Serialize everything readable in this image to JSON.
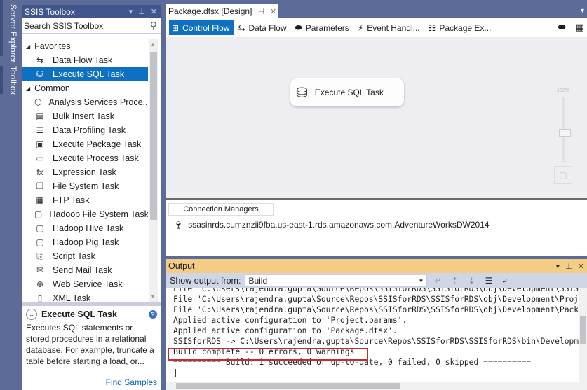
{
  "side_rail": {
    "tabs": [
      "Server Explorer",
      "Toolbox"
    ]
  },
  "toolbox": {
    "title": "SSIS Toolbox",
    "title_buttons": [
      "▾",
      "⊥",
      "✕"
    ],
    "search_placeholder": "Search SSIS Toolbox",
    "groups": [
      {
        "label": "Favorites",
        "items": [
          {
            "label": "Data Flow Task",
            "icon": "data-flow-icon",
            "glyph": "⇆"
          },
          {
            "label": "Execute SQL Task",
            "icon": "execute-sql-icon",
            "glyph": "⛁",
            "selected": true
          }
        ]
      },
      {
        "label": "Common",
        "items": [
          {
            "label": "Analysis Services Proce...",
            "icon": "cube-icon",
            "glyph": "⬡"
          },
          {
            "label": "Bulk Insert Task",
            "icon": "bulk-insert-icon",
            "glyph": "▤"
          },
          {
            "label": "Data Profiling Task",
            "icon": "profiling-icon",
            "glyph": "☰"
          },
          {
            "label": "Execute Package Task",
            "icon": "execute-package-icon",
            "glyph": "▣"
          },
          {
            "label": "Execute Process Task",
            "icon": "execute-process-icon",
            "glyph": "▭"
          },
          {
            "label": "Expression Task",
            "icon": "fx-icon",
            "glyph": "fx"
          },
          {
            "label": "File System Task",
            "icon": "file-system-icon",
            "glyph": "❐"
          },
          {
            "label": "FTP Task",
            "icon": "ftp-icon",
            "glyph": "▦"
          },
          {
            "label": "Hadoop File System Task",
            "icon": "hdfs-icon",
            "glyph": "▢"
          },
          {
            "label": "Hadoop Hive Task",
            "icon": "hive-icon",
            "glyph": "▢"
          },
          {
            "label": "Hadoop Pig Task",
            "icon": "pig-icon",
            "glyph": "▢"
          },
          {
            "label": "Script Task",
            "icon": "script-icon",
            "glyph": "⎘"
          },
          {
            "label": "Send Mail Task",
            "icon": "mail-icon",
            "glyph": "✉"
          },
          {
            "label": "Web Service Task",
            "icon": "globe-icon",
            "glyph": "⊕"
          },
          {
            "label": "XML Task",
            "icon": "xml-icon",
            "glyph": "▯"
          }
        ]
      }
    ],
    "description": {
      "title": "Execute SQL Task",
      "text": "Executes SQL statements or stored procedures in a relational database. For example, truncate a table before starting a load, or...",
      "link": "Find Samples"
    }
  },
  "document": {
    "tab_title": "Package.dtsx [Design]",
    "tab_buttons": [
      "⊣",
      "✕"
    ],
    "design_tabs": [
      {
        "label": "Control Flow",
        "glyph": "⊞",
        "active": true
      },
      {
        "label": "Data Flow",
        "glyph": "⇆"
      },
      {
        "label": "Parameters",
        "glyph": "⬬"
      },
      {
        "label": "Event Handl...",
        "glyph": "⚡"
      },
      {
        "label": "Package Ex...",
        "glyph": "☷"
      }
    ],
    "canvas": {
      "task_label": "Execute SQL Task",
      "zoom_level": "100%"
    },
    "connection_managers": {
      "tab_label": "Connection Managers",
      "items": [
        "ssasinrds.cumznzii9fba.us-east-1.rds.amazonaws.com.AdventureWorksDW2014"
      ]
    }
  },
  "output": {
    "title": "Output",
    "title_buttons": [
      "▾",
      "⊥",
      "✕"
    ],
    "show_output_label": "Show output from:",
    "source": "Build",
    "lines": [
      "File 'C:\\Users\\rajendra.gupta\\Source\\Repos\\SSISforRDS\\SSISforRDS\\obj\\Development\\SSISforRDS.dtproj'",
      "File 'C:\\Users\\rajendra.gupta\\Source\\Repos\\SSISforRDS\\SSISforRDS\\obj\\Development\\Project.params'",
      "File 'C:\\Users\\rajendra.gupta\\Source\\Repos\\SSISforRDS\\SSISforRDS\\obj\\Development\\Package.dtsx'",
      "Applied active configuration to 'Project.params'.",
      "Applied active configuration to 'Package.dtsx'.",
      "SSISforRDS -> C:\\Users\\rajendra.gupta\\Source\\Repos\\SSISforRDS\\SSISforRDS\\bin\\Development\\SSISforRDS.ispac",
      "Build complete -- 0 errors, 0 warnings",
      "========== Build: 1 succeeded or up-to-date, 0 failed, 0 skipped ==========",
      ""
    ]
  },
  "colors": {
    "chrome": "#5d6b99",
    "tool_title": "#40568d",
    "selection": "#0e70c0",
    "output_title": "#f5cc84",
    "highlight_box": "#c42b2b"
  }
}
